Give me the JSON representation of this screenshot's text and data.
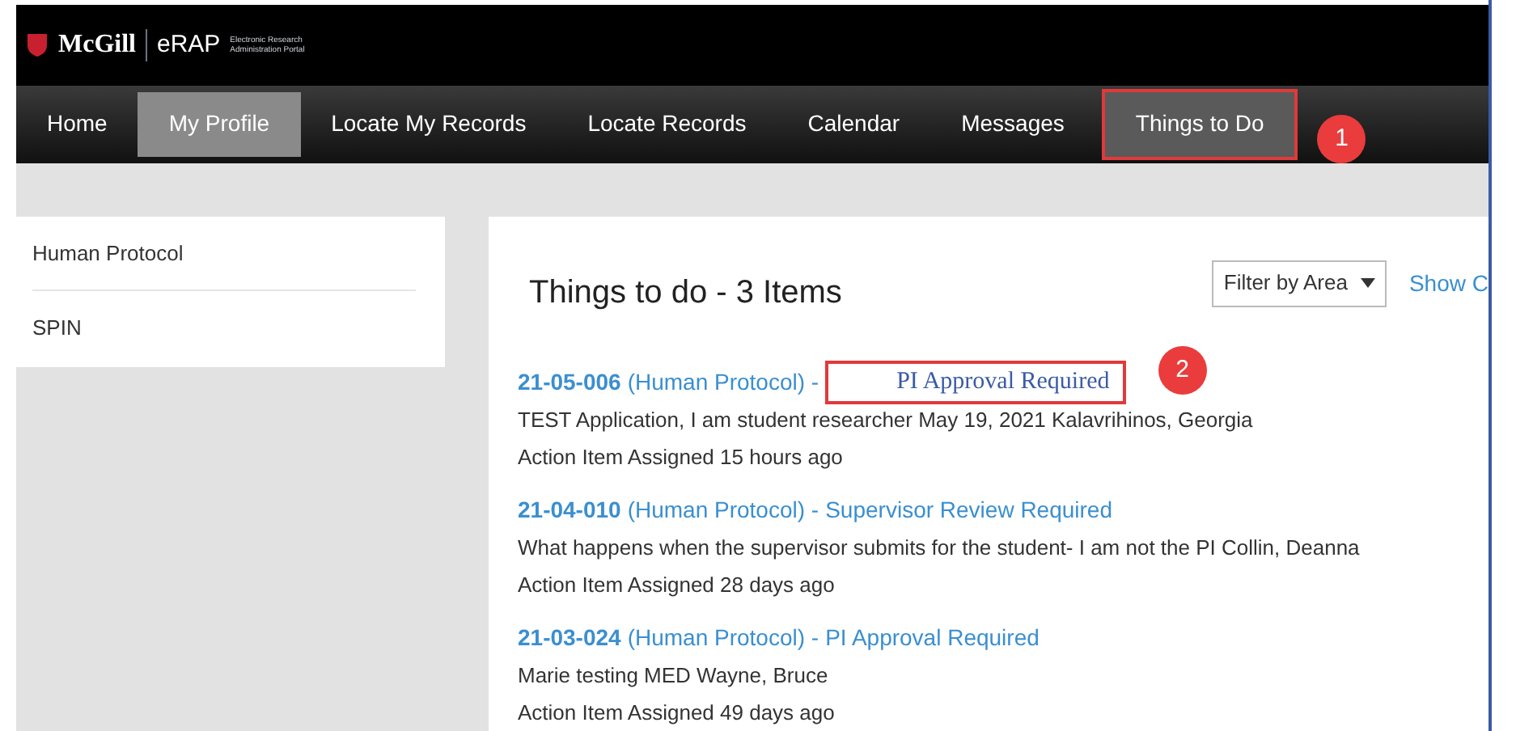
{
  "logo": {
    "brand": "McGill",
    "product": "eRAP",
    "tagline": "Electronic Research Administration Portal"
  },
  "nav": [
    {
      "label": "Home",
      "selected": false,
      "hover": false
    },
    {
      "label": "My Profile",
      "selected": false,
      "hover": true
    },
    {
      "label": "Locate My Records",
      "selected": false,
      "hover": false
    },
    {
      "label": "Locate Records",
      "selected": false,
      "hover": false
    },
    {
      "label": "Calendar",
      "selected": false,
      "hover": false
    },
    {
      "label": "Messages",
      "selected": false,
      "hover": false
    },
    {
      "label": "Things to Do",
      "selected": true,
      "hover": false,
      "callout": "1"
    }
  ],
  "sidebar": {
    "items": [
      "Human Protocol",
      "SPIN"
    ]
  },
  "main": {
    "title": "Things to do - 3 Items",
    "filter": "Filter by Area",
    "link": "Show C",
    "items": [
      {
        "id": "21-05-006",
        "area": "(Human Protocol) -",
        "status": "PI Approval Required",
        "overlay": true,
        "callout": "2",
        "description": "TEST Application, I am student researcher May 19, 2021  Kalavrihinos, Georgia",
        "assigned": "Action Item Assigned 15 hours ago"
      },
      {
        "id": "21-04-010",
        "area": "(Human Protocol) -",
        "status": "Supervisor Review Required",
        "overlay": false,
        "description": "What happens when the supervisor submits for the student- I am not the PI  Collin, Deanna",
        "assigned": "Action Item Assigned 28 days ago"
      },
      {
        "id": "21-03-024",
        "area": "(Human Protocol) -",
        "status": "PI Approval Required",
        "overlay": false,
        "description": "Marie testing MED  Wayne, Bruce",
        "assigned": "Action Item Assigned 49 days ago"
      }
    ]
  }
}
